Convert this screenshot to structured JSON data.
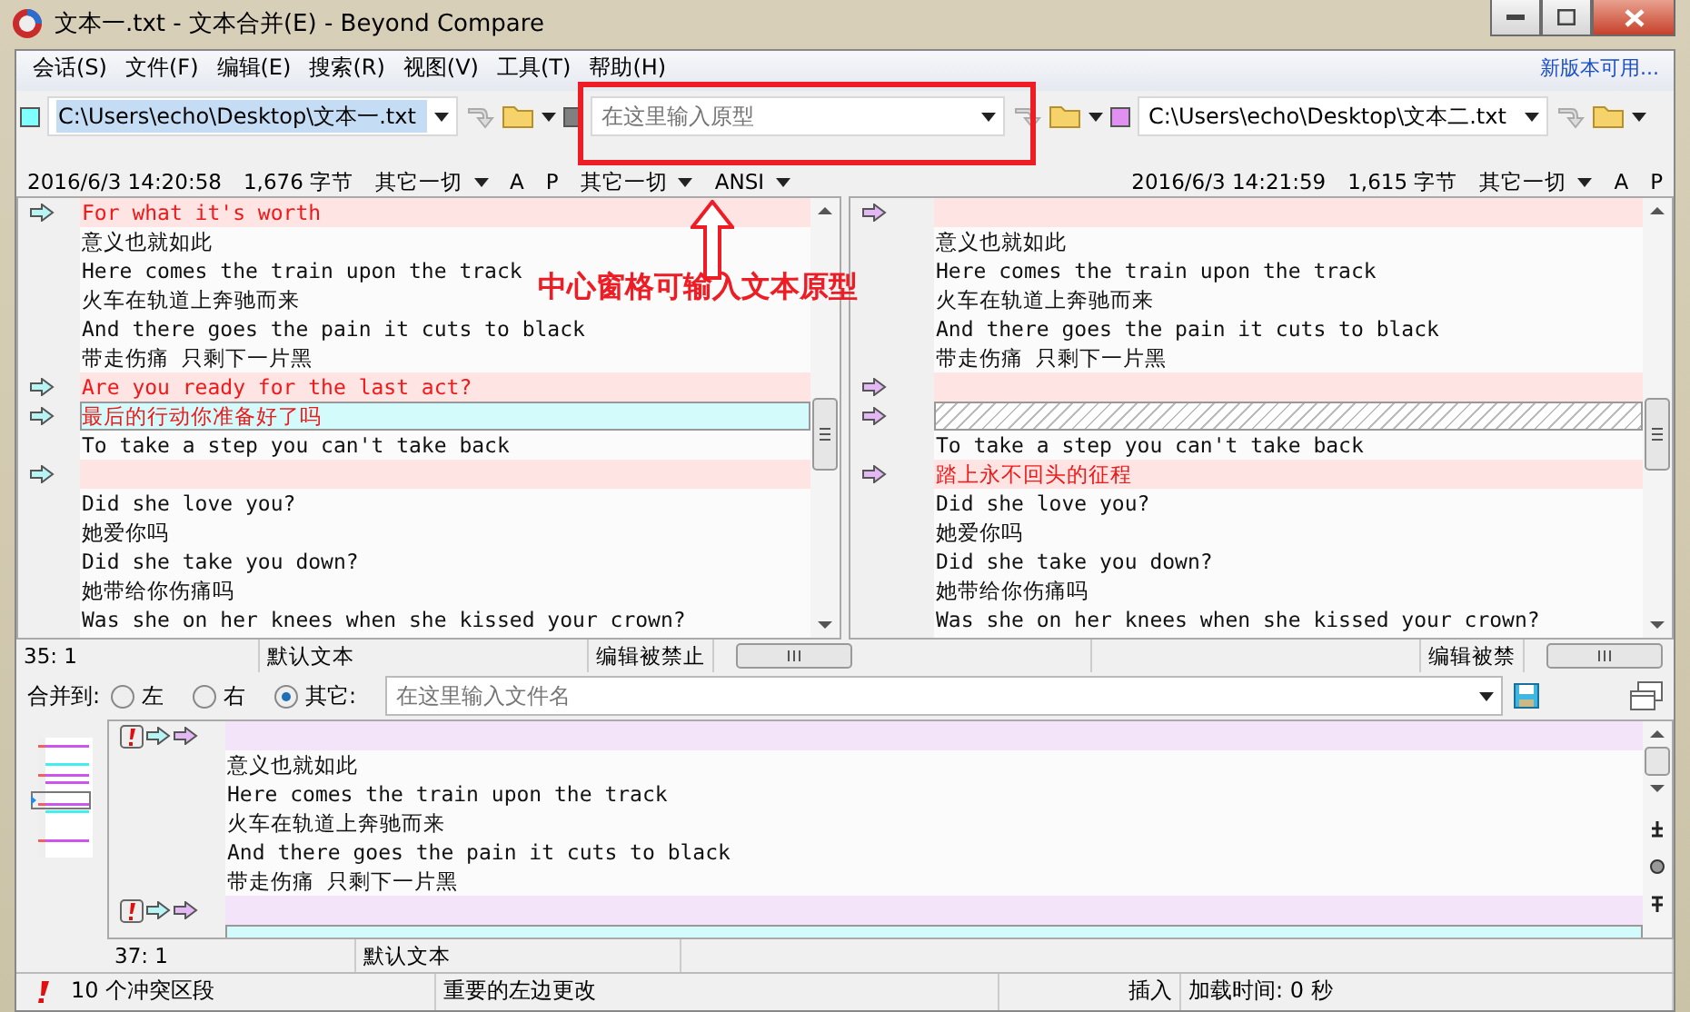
{
  "window": {
    "title": "文本一.txt - 文本合并(E) - Beyond Compare"
  },
  "menu": [
    "会话(S)",
    "文件(F)",
    "编辑(E)",
    "搜索(R)",
    "视图(V)",
    "工具(T)",
    "帮助(H)"
  ],
  "update_link": "新版本可用...",
  "paths": [
    {
      "kind": "file",
      "color": "#80ffff",
      "value": "C:\\Users\\echo\\Desktop\\文本一.txt"
    },
    {
      "kind": "base",
      "color": "#808080",
      "placeholder": "在这里输入原型"
    },
    {
      "kind": "file",
      "color": "#e090f0",
      "value": "C:\\Users\\echo\\Desktop\\文本二.txt"
    }
  ],
  "info": [
    {
      "date": "2016/6/3 14:20:58",
      "size": "1,676 字节",
      "filters": [
        {
          "kind": "dropdown",
          "label": "其它一切"
        },
        {
          "kind": "toggle",
          "label": "A"
        },
        {
          "kind": "toggle",
          "label": "P"
        },
        {
          "kind": "dropdown",
          "label": "其它一切"
        },
        {
          "kind": "dropdown",
          "label": "ANSI"
        }
      ]
    },
    {
      "date": "2016/6/3 14:21:59",
      "size": "1,615 字节",
      "filters": [
        {
          "kind": "dropdown",
          "label": "其它一切"
        },
        {
          "kind": "toggle",
          "label": "A"
        },
        {
          "kind": "toggle",
          "label": "P"
        }
      ]
    }
  ],
  "panes": [
    {
      "rows": [
        {
          "kind": "diff",
          "text": "For what it's worth"
        },
        {
          "kind": "normal",
          "text": "意义也就如此"
        },
        {
          "kind": "normal",
          "text": "Here comes the train upon the track"
        },
        {
          "kind": "normal",
          "text": "火车在轨道上奔驰而来"
        },
        {
          "kind": "normal",
          "text": "And there goes the pain it cuts to black"
        },
        {
          "kind": "normal",
          "text": "带走伤痛 只剩下一片黑"
        },
        {
          "kind": "diff",
          "text": "Are you ready for the last act?"
        },
        {
          "kind": "current",
          "text": "最后的行动你准备好了吗"
        },
        {
          "kind": "normal",
          "text": "To take a step you can't take back"
        },
        {
          "kind": "diff"
        },
        {
          "kind": "normal",
          "text": "Did she love you?"
        },
        {
          "kind": "normal",
          "text": "她爱你吗"
        },
        {
          "kind": "normal",
          "text": "Did she take you down?"
        },
        {
          "kind": "normal",
          "text": "她带给你伤痛吗"
        },
        {
          "kind": "normal",
          "text": "Was she on her knees when she kissed your crown?"
        }
      ],
      "status": {
        "position": "35: 1",
        "format": "默认文本",
        "edit": "编辑被禁止"
      }
    },
    {
      "rows": [
        {
          "kind": "diff"
        },
        {
          "kind": "normal",
          "text": "意义也就如此"
        },
        {
          "kind": "normal",
          "text": "Here comes the train upon the track"
        },
        {
          "kind": "normal",
          "text": "火车在轨道上奔驰而来"
        },
        {
          "kind": "normal",
          "text": "And there goes the pain it cuts to black"
        },
        {
          "kind": "normal",
          "text": "带走伤痛 只剩下一片黑"
        },
        {
          "kind": "diff"
        },
        {
          "kind": "hatched"
        },
        {
          "kind": "normal",
          "text": "To take a step you can't take back"
        },
        {
          "kind": "diff",
          "text": "踏上永不回头的征程"
        },
        {
          "kind": "normal",
          "text": "Did she love you?"
        },
        {
          "kind": "normal",
          "text": "她爱你吗"
        },
        {
          "kind": "normal",
          "text": "Did she take you down?"
        },
        {
          "kind": "normal",
          "text": "她带给你伤痛吗"
        },
        {
          "kind": "normal",
          "text": "Was she on her knees when she kissed your crown?"
        }
      ],
      "status": {
        "edit": "编辑被禁"
      }
    }
  ],
  "merge": {
    "label": "合并到:",
    "options": [
      {
        "label": "左",
        "selected": false
      },
      {
        "label": "右",
        "selected": false
      },
      {
        "label": "其它:",
        "selected": true
      }
    ],
    "placeholder": "在这里输入文件名"
  },
  "output": {
    "rows": [
      {
        "kind": "conflict"
      },
      {
        "kind": "normal",
        "text": "意义也就如此"
      },
      {
        "kind": "normal",
        "text": "Here comes the train upon the track"
      },
      {
        "kind": "normal",
        "text": "火车在轨道上奔驰而来"
      },
      {
        "kind": "normal",
        "text": "And there goes the pain it cuts to black"
      },
      {
        "kind": "normal",
        "text": "带走伤痛 只剩下一片黑"
      },
      {
        "kind": "conflict"
      },
      {
        "kind": "current"
      }
    ],
    "status": {
      "position": "37: 1",
      "format": "默认文本"
    }
  },
  "status_bar": {
    "conflicts": "10 个冲突区段",
    "change": "重要的左边更改",
    "mode": "插入",
    "load_time": "加载时间: 0 秒"
  },
  "annotation": {
    "text": "中心窗格可输入文本原型"
  }
}
